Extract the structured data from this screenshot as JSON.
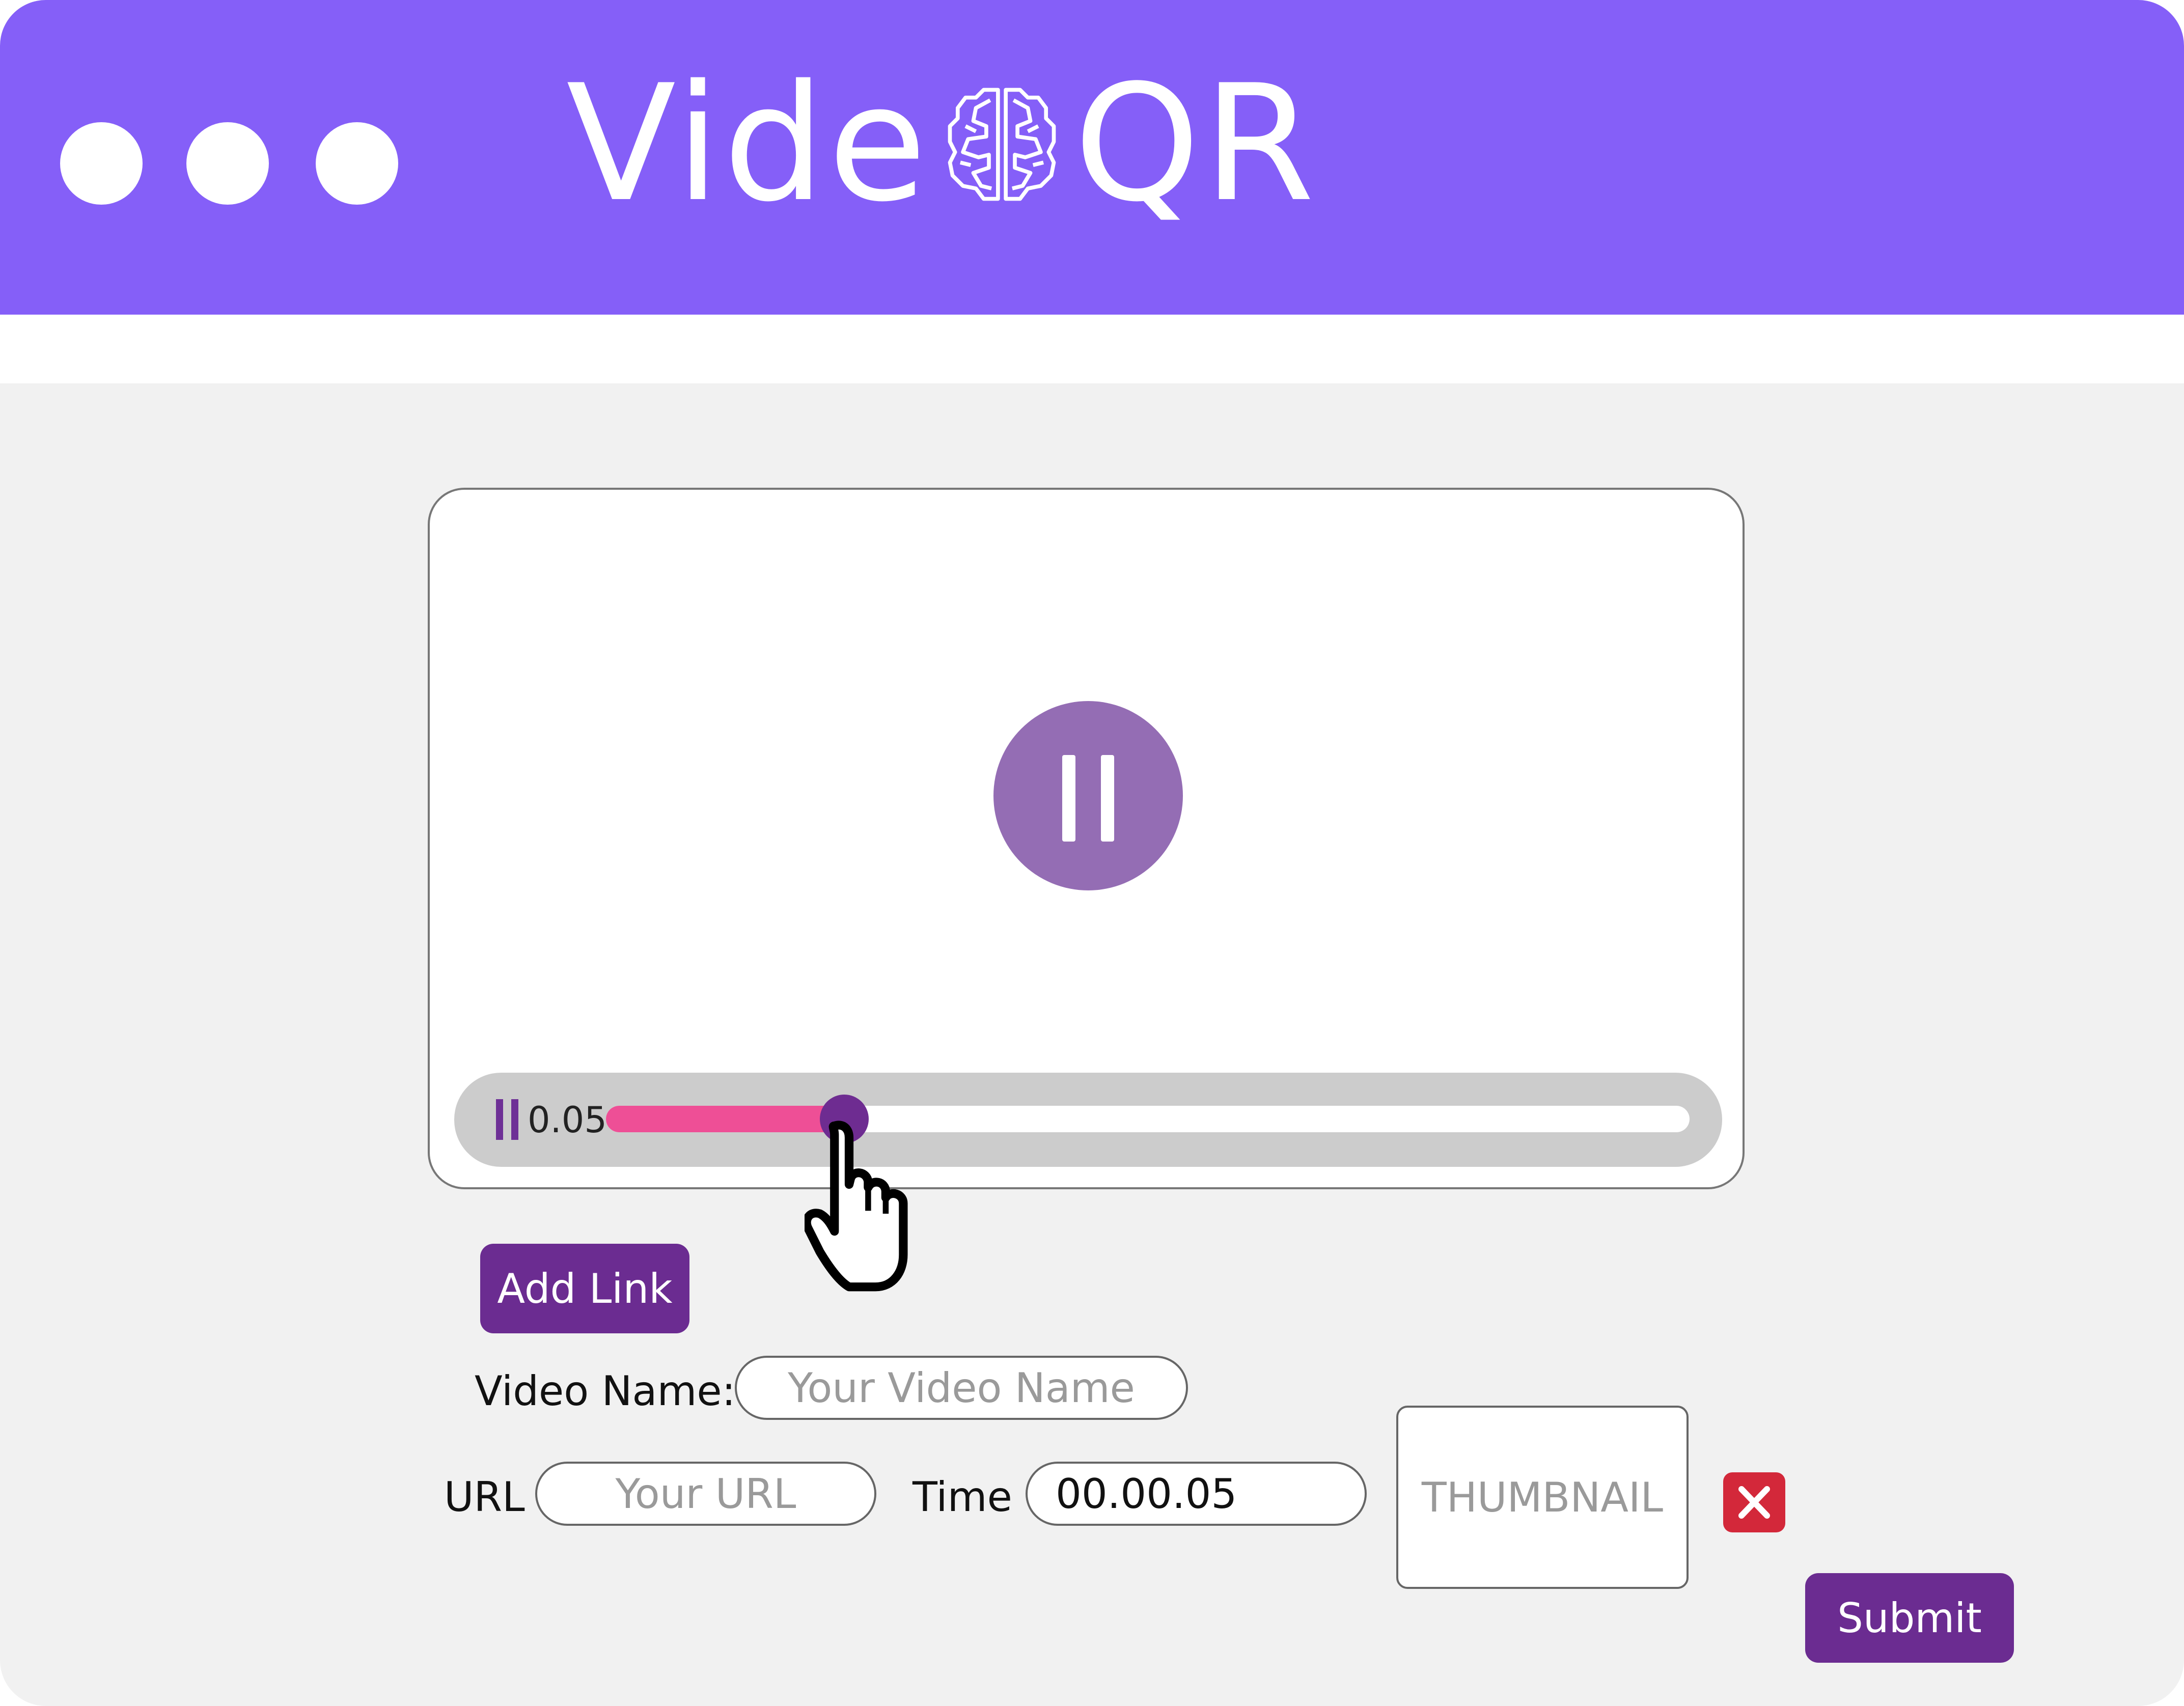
{
  "app": {
    "title_prefix": "Vide",
    "title_suffix": "QR",
    "logo_icon": "brain-icon"
  },
  "window_controls": [
    "dot",
    "dot",
    "dot"
  ],
  "player": {
    "state_icon": "pause-icon",
    "current_time": "0.05",
    "progress": 0.22
  },
  "form": {
    "add_link_label": "Add Link",
    "video_name_label": "Video Name:",
    "video_name_placeholder": "Your Video Name",
    "url_label": "URL",
    "url_placeholder": "Your URL",
    "time_label": "Time",
    "time_value": "00.00.05",
    "thumbnail_label": "THUMBNAIL",
    "remove_icon": "close-icon",
    "submit_label": "Submit"
  },
  "colors": {
    "header": "#855ff8",
    "accent": "#6b2c91",
    "progress": "#ee4f96",
    "play_button": "#946db4",
    "remove": "#d3283a"
  }
}
